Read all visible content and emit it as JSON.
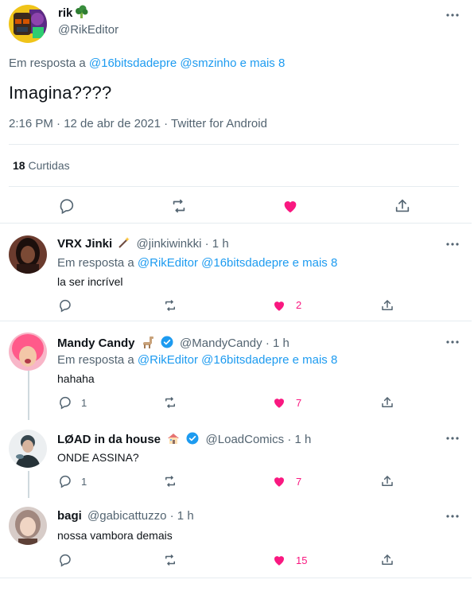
{
  "main_tweet": {
    "name": "rik",
    "handle": "@RikEditor",
    "replying_prefix": "Em resposta a",
    "replying_mentions": "@16bitsdadepre @smzinho e mais 8",
    "text": "Imagina????",
    "timestamp": "2:16 PM · 12 de abr de 2021 · Twitter for Android",
    "likes_count": "18",
    "likes_label": "Curtidas",
    "liked": true
  },
  "replies": [
    {
      "name": "VRX Jinki",
      "handle": "@jinkiwinkki",
      "time": "· 1 h",
      "replying_prefix": "Em resposta a",
      "replying_mentions": "@RikEditor @16bitsdadepre e mais 8",
      "text": "la ser incrível",
      "reply_count": "",
      "like_count": "2",
      "verified": false
    },
    {
      "name": "Mandy Candy",
      "handle": "@MandyCandy",
      "time": "· 1 h",
      "replying_prefix": "Em resposta a",
      "replying_mentions": "@RikEditor @16bitsdadepre e mais 8",
      "text": "hahaha",
      "reply_count": "1",
      "like_count": "7",
      "verified": true
    },
    {
      "name": "LØAD in da house",
      "handle": "@LoadComics",
      "time": "· 1 h",
      "text": "ONDE ASSINA?",
      "reply_count": "1",
      "like_count": "7",
      "verified": true
    },
    {
      "name": "bagi",
      "handle": "@gabicattuzzo",
      "time": "· 1 h",
      "text": "nossa vambora demais",
      "reply_count": "",
      "like_count": "15",
      "verified": false
    }
  ],
  "colors": {
    "accent": "#1d9bf0",
    "like": "#f91880",
    "text": "#0f1419",
    "muted": "#536471",
    "border": "#e6ecf0"
  }
}
